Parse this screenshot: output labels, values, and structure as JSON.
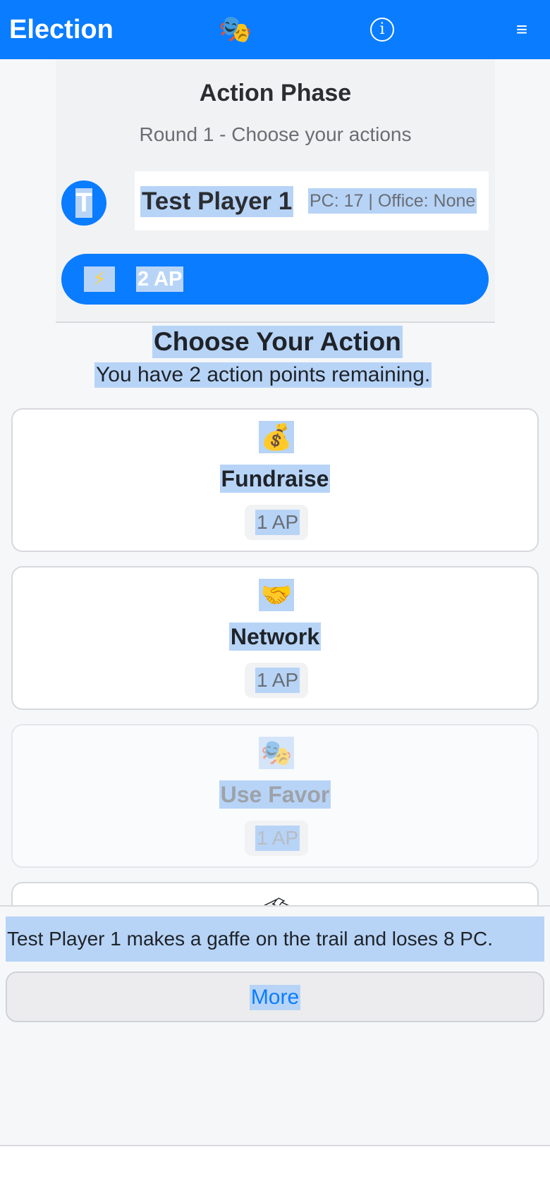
{
  "header": {
    "title": "Election",
    "logo_icon": "theater-masks-icon",
    "info_glyph": "i",
    "menu_glyph": "≡"
  },
  "phase": {
    "title": "Action Phase",
    "subtitle": "Round 1 - Choose your actions",
    "player": {
      "avatar_initial": "T",
      "name": "Test Player 1",
      "stats": "PC: 17 | Office: None"
    },
    "ap_icon": "⚡",
    "ap_value": "2 AP"
  },
  "actions": {
    "title": "Choose Your Action",
    "subtitle": "You have 2 action points remaining.",
    "items": [
      {
        "icon": "💰",
        "name": "Fundraise",
        "cost": "1 AP",
        "enabled": true
      },
      {
        "icon": "🤝",
        "name": "Network",
        "cost": "1 AP",
        "enabled": true
      },
      {
        "icon": "🎭",
        "name": "Use Favor",
        "cost": "1 AP",
        "enabled": false
      },
      {
        "icon": "🗳",
        "name": "",
        "cost": "",
        "enabled": true
      }
    ]
  },
  "log": {
    "message": "Test Player 1 makes a gaffe on the trail and loses 8 PC.",
    "more_label": "More"
  },
  "colors": {
    "primary": "#0a7cff",
    "selection": "#b7d4f7",
    "background": "#f6f7f9"
  }
}
